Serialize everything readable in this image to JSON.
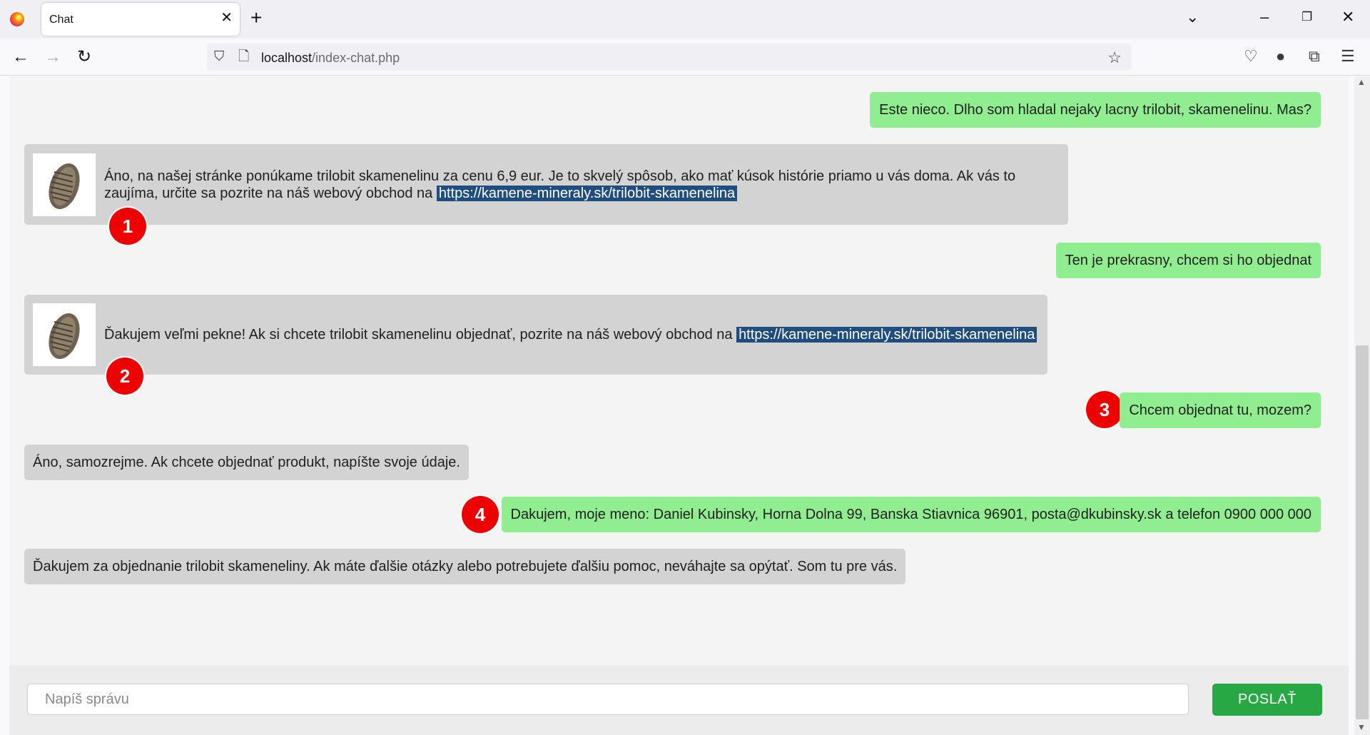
{
  "browser": {
    "tab_title": "Chat",
    "url_host": "localhost",
    "url_path": "/index-chat.php"
  },
  "messages": [
    {
      "role": "user",
      "text": "Este nieco. Dlho som hladal nejaky lacny trilobit, skamenelinu. Mas?"
    },
    {
      "role": "bot",
      "text_1": "Áno, na našej stránke ponúkame trilobit skamenelinu za cenu 6,9 eur. Je to skvelý spôsob, ako mať kúsok histórie priamo u vás doma. Ak vás to zaujíma, určite sa pozrite na náš webový obchod na",
      "link": "https://kamene-mineraly.sk/trilobit-skamenelina"
    },
    {
      "role": "user",
      "text": "Ten je prekrasny, chcem si ho objednat"
    },
    {
      "role": "bot",
      "text_1": "Ďakujem veľmi pekne! Ak si chcete trilobit skamenelinu objednať, pozrite na náš webový obchod na",
      "link": "https://kamene-mineraly.sk/trilobit-skamenelina"
    },
    {
      "role": "user",
      "text": "Chcem objednat tu, mozem?"
    },
    {
      "role": "bot",
      "text": "Áno, samozrejme. Ak chcete objednať produkt, napíšte svoje údaje."
    },
    {
      "role": "user",
      "text": "Dakujem, moje meno: Daniel Kubinsky, Horna Dolna 99, Banska Stiavnica 96901, posta@dkubinsky.sk a telefon 0900 000 000"
    },
    {
      "role": "bot",
      "text": "Ďakujem za objednanie trilobit skameneliny. Ak máte ďalšie otázky alebo potrebujete ďalšiu pomoc, neváhajte sa opýtať. Som tu pre vás."
    }
  ],
  "badges": [
    "1",
    "2",
    "3",
    "4"
  ],
  "composer": {
    "placeholder": "Napíš správu",
    "send_label": "POSLAŤ"
  },
  "colors": {
    "user_bubble": "#90ee90",
    "bot_bubble": "#d3d3d3",
    "link_bg": "#1e4d7e",
    "badge": "#ee0000",
    "send_button": "#27a845"
  }
}
